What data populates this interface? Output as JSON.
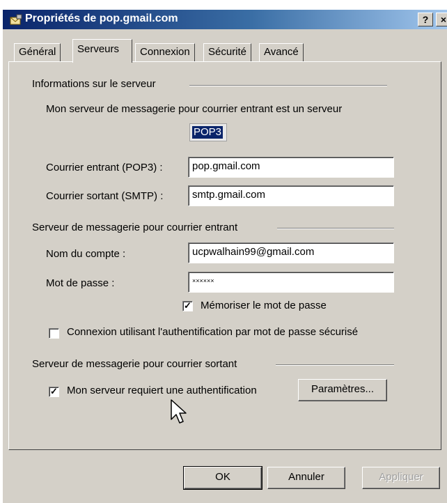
{
  "window": {
    "title": "Propriétés de pop.gmail.com",
    "help_label": "?",
    "close_label": "×"
  },
  "tabs": [
    {
      "label": "Général",
      "active": false
    },
    {
      "label": "Serveurs",
      "active": true
    },
    {
      "label": "Connexion",
      "active": false
    },
    {
      "label": "Sécurité",
      "active": false
    },
    {
      "label": "Avancé",
      "active": false
    }
  ],
  "server_info": {
    "section_title": "Informations sur le serveur",
    "incoming_type_text": "Mon serveur de messagerie pour courrier entrant est un serveur",
    "incoming_type_value": "POP3",
    "incoming_label": "Courrier entrant (POP3) :",
    "incoming_value": "pop.gmail.com",
    "outgoing_label": "Courrier sortant (SMTP) :",
    "outgoing_value": "smtp.gmail.com"
  },
  "incoming_server": {
    "section_title": "Serveur de messagerie pour courrier entrant",
    "account_label": "Nom du compte :",
    "account_value": "ucpwalhain99@gmail.com",
    "password_label": "Mot de passe :",
    "password_value": "××××××",
    "remember_label": "Mémoriser le mot de passe",
    "remember_checked": true,
    "spa_label": "Connexion utilisant l'authentification par mot de passe sécurisé",
    "spa_checked": false
  },
  "outgoing_server": {
    "section_title": "Serveur de messagerie pour courrier sortant",
    "auth_label": "Mon serveur requiert une authentification",
    "auth_checked": true,
    "settings_button": "Paramètres..."
  },
  "buttons": {
    "ok": "OK",
    "cancel": "Annuler",
    "apply": "Appliquer"
  },
  "checkmark": "✓",
  "colors": {
    "titlebar_start": "#0a246a",
    "titlebar_end": "#a6caf0",
    "dialog_bg": "#d4d0c8",
    "selection": "#0a246a"
  }
}
